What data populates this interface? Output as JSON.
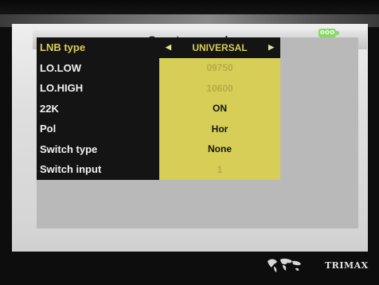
{
  "header": {
    "title": "Spectrum analyzer",
    "battery_icon": "battery-icon",
    "battery_label": "ooo"
  },
  "settings": {
    "rows": [
      {
        "label": "LNB type",
        "value": "UNIVERSAL",
        "selected": true,
        "dimmed": false
      },
      {
        "label": "LO.LOW",
        "value": "09750",
        "selected": false,
        "dimmed": true
      },
      {
        "label": "LO.HIGH",
        "value": "10600",
        "selected": false,
        "dimmed": true
      },
      {
        "label": "22K",
        "value": "ON",
        "selected": false,
        "dimmed": false
      },
      {
        "label": "Pol",
        "value": "Hor",
        "selected": false,
        "dimmed": false
      },
      {
        "label": "Switch type",
        "value": "None",
        "selected": false,
        "dimmed": false
      },
      {
        "label": "Switch input",
        "value": "1",
        "selected": false,
        "dimmed": true
      }
    ],
    "left_arrow_icon": "arrow-left-icon",
    "right_arrow_icon": "arrow-right-icon"
  },
  "footer": {
    "brand": "TRIMAX",
    "logo_icon": "world-map-icon"
  },
  "colors": {
    "row_value_bg": "#d6ce57",
    "row_label_bg": "#141414",
    "selected_text": "#d6ce57",
    "panel_bg": "#dedede"
  }
}
